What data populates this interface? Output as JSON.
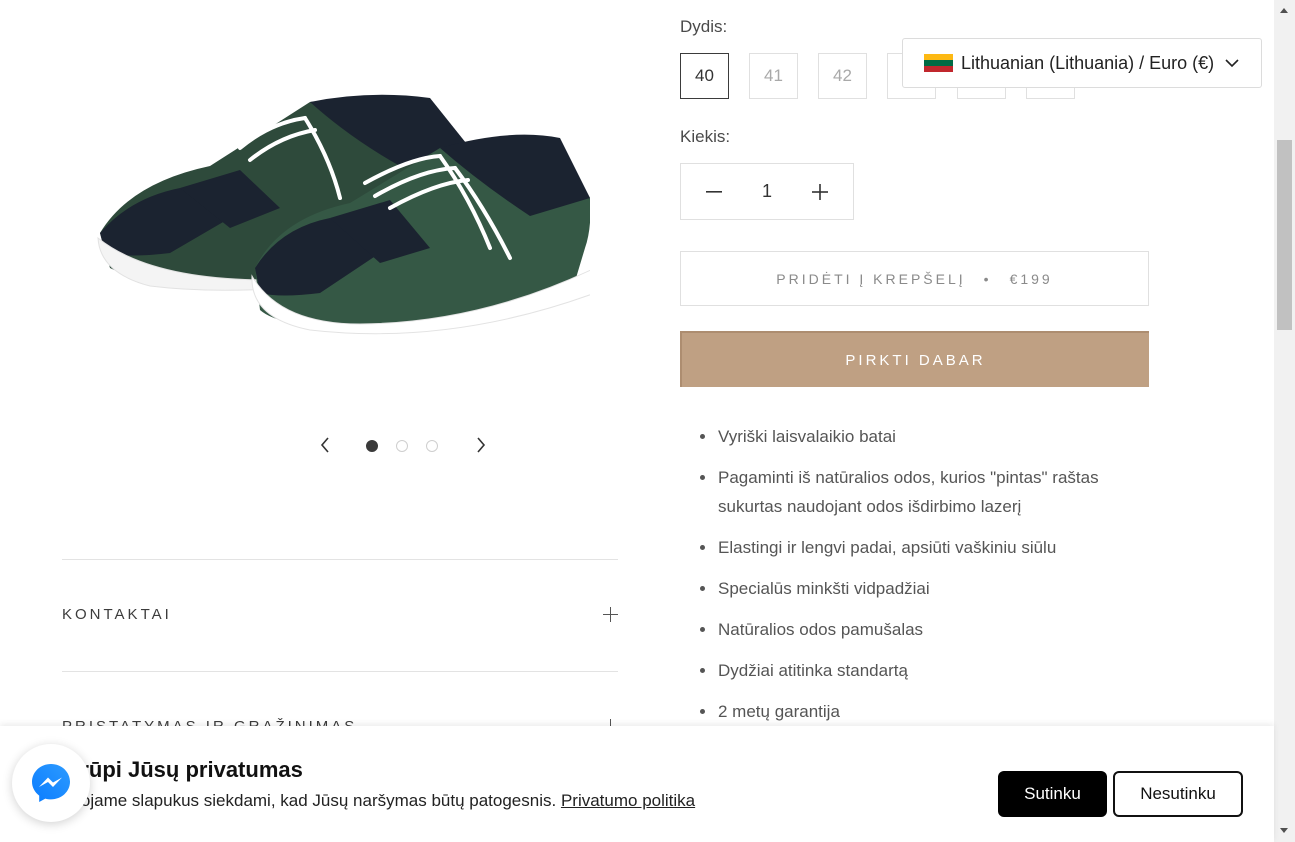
{
  "gallery": {
    "image_alt": "shoe-product-image",
    "current_slide": 1,
    "slide_count": 3
  },
  "accordions": [
    {
      "title": "KONTAKTAI"
    },
    {
      "title": "PRISTATYMAS IR GRĄŽINIMAS"
    }
  ],
  "product_form": {
    "size_label": "Dydis:",
    "sizes": [
      "40",
      "41",
      "42",
      "",
      "",
      ""
    ],
    "selected_size": "40",
    "quantity_label": "Kiekis:",
    "quantity": "1",
    "add_to_cart_label": "PRIDĖTI Į KREPŠELĮ",
    "separator": "•",
    "price": "€199",
    "buy_now_label": "PIRKTI DABAR",
    "accent_color": "#bfa083"
  },
  "features": [
    "Vyriški laisvalaikio batai",
    "Pagaminti iš natūralios odos, kurios \"pintas\" raštas sukurtas naudojant odos išdirbimo lazerį",
    "Elastingi ir lengvi padai, apsiūti vaškiniu siūlu",
    "Specialūs minkšti vidpadžiai",
    "Natūralios odos pamušalas",
    "Dydžiai atitinka standartą",
    "2 metų garantija"
  ],
  "language_selector": {
    "label": "Lithuanian (Lithuania) / Euro (€)",
    "flag_colors": [
      "#fdb913",
      "#006a44",
      "#c1272d"
    ]
  },
  "cookie_banner": {
    "title": "s rūpi Jūsų privatumas",
    "text": "udojame slapukus siekdami, kad Jūsų naršymas būtų patogesnis.",
    "link": "Privatumo politika",
    "accept": "Sutinku",
    "decline": "Nesutinku"
  },
  "icons": {
    "prev": "chevron-left-icon",
    "next": "chevron-right-icon",
    "minus": "minus-icon",
    "plus": "plus-icon",
    "dropdown": "chevron-down-icon",
    "messenger": "messenger-icon"
  }
}
